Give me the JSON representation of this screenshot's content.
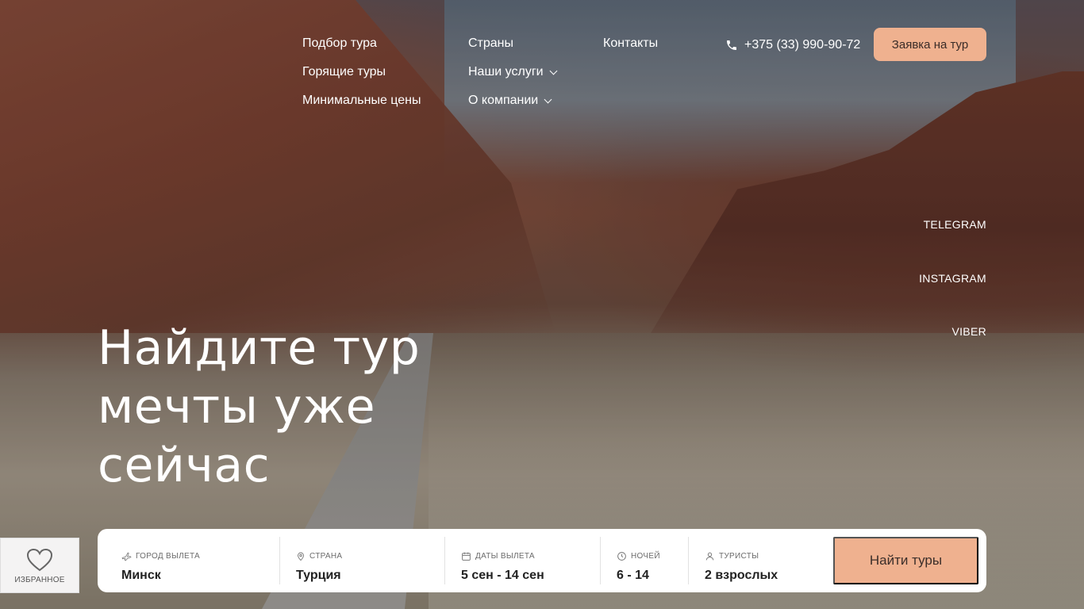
{
  "nav": {
    "col1": [
      "Подбор тура",
      "Горящие туры",
      "Минимальные цены"
    ],
    "col2": [
      "Страны",
      "Наши услуги",
      "О компании"
    ],
    "col3": [
      "Контакты"
    ]
  },
  "phone": "+375 (33) 990-90-72",
  "cta_label": "Заявка на тур",
  "social": [
    "TELEGRAM",
    "INSTAGRAM",
    "VIBER"
  ],
  "hero": {
    "line1": "Найдите тур",
    "line2": "мечты уже",
    "line3": "сейчас"
  },
  "favorites_label": "ИЗБРАННОЕ",
  "search": {
    "departure": {
      "label": "ГОРОД ВЫЛЕТА",
      "value": "Минск"
    },
    "country": {
      "label": "СТРАНА",
      "value": "Турция"
    },
    "dates": {
      "label": "ДАТЫ ВЫЛЕТА",
      "value": "5 сен - 14 сен"
    },
    "nights": {
      "label": "НОЧЕЙ",
      "value": "6 - 14"
    },
    "tourists": {
      "label": "ТУРИСТЫ",
      "value": "2 взрослых"
    },
    "button": "Найти туры"
  },
  "colors": {
    "accent": "#efb18f",
    "text_dark": "#222222"
  }
}
